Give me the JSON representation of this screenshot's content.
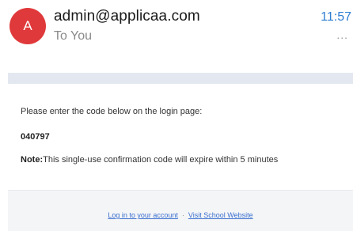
{
  "header": {
    "avatar_letter": "A",
    "sender": "admin@applicaa.com",
    "recipient": "To You",
    "time": "11:57",
    "more": "..."
  },
  "body": {
    "intro": "Please enter the code below on the login page:",
    "code": "040797",
    "note_label": "Note:",
    "note_text": "This single-use confirmation code will expire within 5 minutes"
  },
  "footer": {
    "login_link": "Log in to your account",
    "separator": "·",
    "school_link": "Visit School Website"
  },
  "colors": {
    "avatar": "#e0393b",
    "time": "#2d7dd2",
    "link": "#3a6fcf"
  }
}
